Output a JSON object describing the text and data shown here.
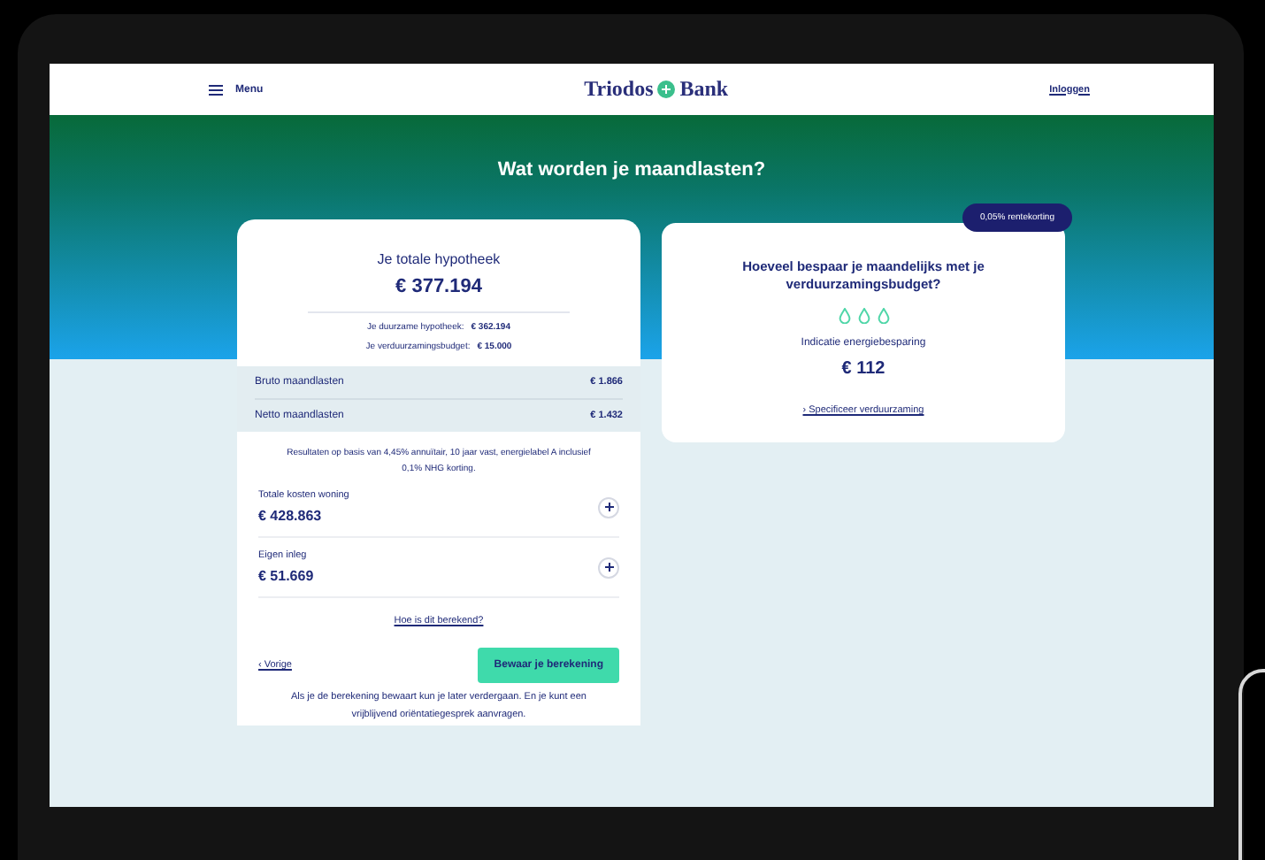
{
  "header": {
    "menu_label": "Menu",
    "logo_left": "Triodos",
    "logo_right": "Bank",
    "login_link": "Inloggen"
  },
  "title": "Wat worden je maandlasten?",
  "mortgage_card": {
    "heading": "Je totale hypotheek",
    "total": "€ 377.194",
    "breakdown": [
      {
        "label": "Je duurzame hypotheek:",
        "value": "€ 362.194"
      },
      {
        "label": "Je verduurzamingsbudget:",
        "value": "€ 15.000"
      }
    ],
    "monthly": [
      {
        "label": "Bruto maandlasten",
        "value": "€ 1.866"
      },
      {
        "label": "Netto maandlasten",
        "value": "€ 1.432"
      }
    ],
    "note": "Resultaten op basis van 4,45% annuïtair, 10 jaar vast, energielabel A inclusief 0,1% NHG korting.",
    "fields": [
      {
        "label": "Totale kosten woning",
        "value": "€ 428.863"
      },
      {
        "label": "Eigen inleg",
        "value": "€ 51.669"
      }
    ],
    "explain_link": "Hoe is dit berekend?",
    "back_link": "‹ Vorige",
    "save_button": "Bewaar je berekening",
    "footer_note": "Als je de berekening bewaart kun je later verdergaan. En je kunt een vrijblijvend oriëntatiegesprek aanvragen."
  },
  "savings_card": {
    "badge": "0,05% rentekorting",
    "heading": "Hoeveel bespaar je maandelijks met je verduurzamingsbudget?",
    "caption": "Indicatie energiebesparing",
    "amount": "€ 112",
    "link": "› Specificeer verduurzaming"
  }
}
